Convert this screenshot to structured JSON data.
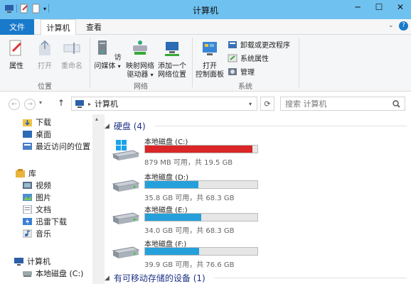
{
  "window": {
    "title": "计算机"
  },
  "tabs": {
    "file": "文件",
    "computer": "计算机",
    "view": "查看"
  },
  "ribbon": {
    "location": {
      "label": "位置",
      "properties": "属性",
      "open": "打开",
      "rename": "重命名"
    },
    "network": {
      "label": "网络",
      "access_media": "访问媒体",
      "map_drive_1": "映射网络",
      "map_drive_2": "驱动器",
      "add_location_1": "添加一个",
      "add_location_2": "网络位置"
    },
    "system": {
      "label": "系统",
      "control_panel_1": "打开",
      "control_panel_2": "控制面板",
      "uninstall": "卸载或更改程序",
      "sys_props": "系统属性",
      "manage": "管理"
    }
  },
  "address": {
    "path": "计算机",
    "search_placeholder": "搜索 计算机"
  },
  "nav_items": [
    {
      "label": "下载",
      "icon": "download-folder-icon"
    },
    {
      "label": "桌面",
      "icon": "desktop-icon"
    },
    {
      "label": "最近访问的位置",
      "icon": "recent-places-icon"
    },
    {
      "label": "库",
      "icon": "library-icon"
    },
    {
      "label": "视频",
      "icon": "videos-icon"
    },
    {
      "label": "图片",
      "icon": "pictures-icon"
    },
    {
      "label": "文档",
      "icon": "documents-icon"
    },
    {
      "label": "迅雷下载",
      "icon": "thunder-download-icon"
    },
    {
      "label": "音乐",
      "icon": "music-icon"
    },
    {
      "label": "计算机",
      "icon": "computer-icon"
    },
    {
      "label": "本地磁盘 (C:)",
      "icon": "drive-icon"
    }
  ],
  "sections": {
    "hdd": "硬盘 (4)",
    "removable": "有可移动存储的设备 (1)"
  },
  "drives": [
    {
      "name": "本地磁盘 (C:)",
      "info": "879 MB 可用，共 19.5 GB",
      "used_fraction": 0.956,
      "color": "#da2626"
    },
    {
      "name": "本地磁盘 (D:)",
      "info": "35.8 GB 可用，共 68.3 GB",
      "used_fraction": 0.476,
      "color": "#26a0da"
    },
    {
      "name": "本地磁盘 (E:)",
      "info": "34.0 GB 可用，共 68.3 GB",
      "used_fraction": 0.502,
      "color": "#26a0da"
    },
    {
      "name": "本地磁盘 (F:)",
      "info": "39.9 GB 可用，共 76.6 GB",
      "used_fraction": 0.479,
      "color": "#26a0da"
    }
  ]
}
